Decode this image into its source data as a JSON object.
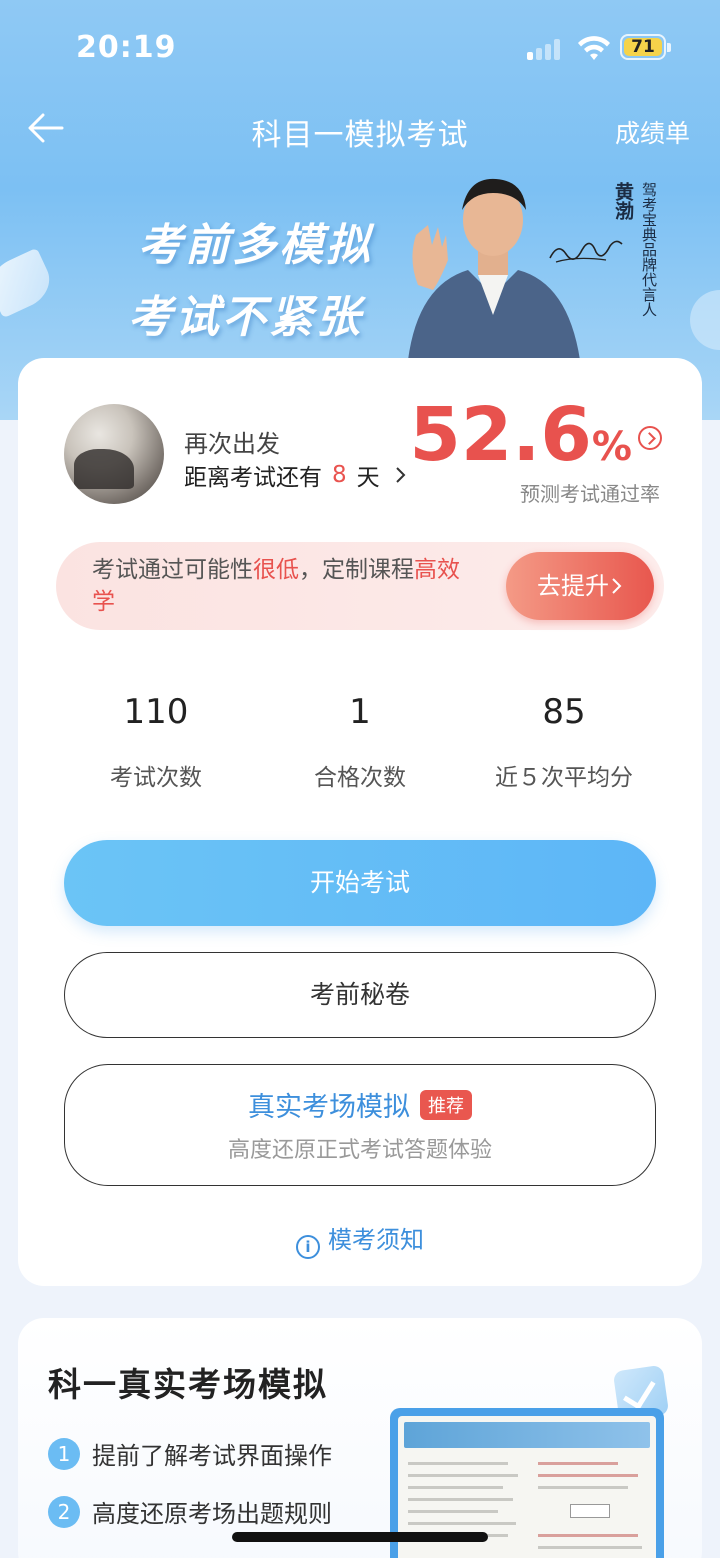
{
  "status": {
    "time": "20:19",
    "battery": "71",
    "icons": [
      "signal-icon",
      "wifi-icon",
      "battery-icon"
    ]
  },
  "nav": {
    "title": "科目一模拟考试",
    "right_link": "成绩单",
    "back_icon": "back-arrow-icon"
  },
  "banner": {
    "slogan_line1": "考前多模拟",
    "slogan_line2": "考试不紧张",
    "ambassador_name": "黄渤",
    "ambassador_tag": "驾考宝典品牌代言人"
  },
  "profile": {
    "name": "再次出发",
    "countdown_prefix": "距离考试还有",
    "countdown_days": "8",
    "countdown_suffix": "天"
  },
  "pass_rate": {
    "value": "52.6",
    "unit": "%",
    "label": "预测考试通过率"
  },
  "alert": {
    "text_part1": "考试通过可能性",
    "text_highlight1": "很低",
    "text_part2": "，定制课程",
    "text_highlight2": "高效学",
    "button": "去提升"
  },
  "stats": [
    {
      "value": "110",
      "label": "考试次数"
    },
    {
      "value": "1",
      "label": "合格次数"
    },
    {
      "value": "85",
      "label": "近５次平均分"
    }
  ],
  "buttons": {
    "start": "开始考试",
    "secret": "考前秘卷",
    "real_title": "真实考场模拟",
    "real_badge": "推荐",
    "real_subtitle": "高度还原正式考试答题体验"
  },
  "notice": "模考须知",
  "section2": {
    "title": "科一真实考场模拟",
    "features": [
      {
        "num": "1",
        "text": "提前了解考试界面操作"
      },
      {
        "num": "2",
        "text": "高度还原考场出题规则"
      }
    ]
  },
  "colors": {
    "accent_red": "#e8524e",
    "accent_blue": "#3d8fdc",
    "start_button": "#5db6f7"
  }
}
